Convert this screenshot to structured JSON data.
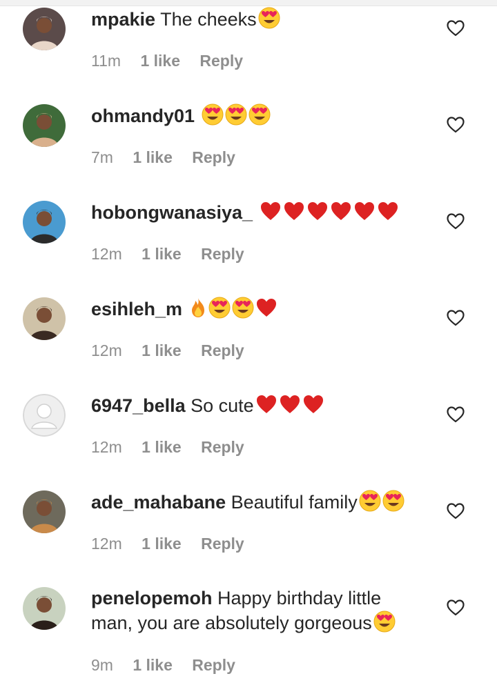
{
  "comments": [
    {
      "username": "mpakie",
      "text": "The cheeks",
      "emojis": [
        "heart-eyes"
      ],
      "time": "11m",
      "likes": "1 like",
      "reply": "Reply",
      "avatar_colors": [
        "#5b4b4a",
        "#e8d6c8"
      ]
    },
    {
      "username": "ohmandy01",
      "text": "",
      "emojis": [
        "heart-eyes",
        "heart-eyes",
        "heart-eyes"
      ],
      "time": "7m",
      "likes": "1 like",
      "reply": "Reply",
      "avatar_colors": [
        "#3f6b3a",
        "#d9b08c"
      ]
    },
    {
      "username": "hobongwanasiya_",
      "text": "",
      "emojis": [
        "red-heart",
        "red-heart",
        "red-heart",
        "red-heart",
        "red-heart",
        "red-heart"
      ],
      "time": "12m",
      "likes": "1 like",
      "reply": "Reply",
      "avatar_colors": [
        "#4a9bd0",
        "#2b2b2b"
      ]
    },
    {
      "username": "esihleh_m",
      "text": "",
      "emojis": [
        "fire",
        "heart-eyes",
        "heart-eyes",
        "red-heart"
      ],
      "time": "12m",
      "likes": "1 like",
      "reply": "Reply",
      "avatar_colors": [
        "#cfc2a8",
        "#3a2a22"
      ]
    },
    {
      "username": "6947_bella",
      "text": "So cute",
      "emojis": [
        "red-heart",
        "red-heart",
        "red-heart"
      ],
      "time": "12m",
      "likes": "1 like",
      "reply": "Reply",
      "avatar_colors": [
        "#e6e6e6",
        "#ffffff"
      ]
    },
    {
      "username": "ade_mahabane",
      "text": "Beautiful family",
      "emojis": [
        "heart-eyes",
        "heart-eyes"
      ],
      "time": "12m",
      "likes": "1 like",
      "reply": "Reply",
      "avatar_colors": [
        "#6e6a5c",
        "#c98a4a"
      ]
    },
    {
      "username": "penelopemoh",
      "text": "Happy birthday little man, you are absolutely gorgeous",
      "emojis": [
        "heart-eyes"
      ],
      "time": "9m",
      "likes": "1 like",
      "reply": "Reply",
      "avatar_colors": [
        "#c8d2bf",
        "#2a1f1a"
      ]
    }
  ]
}
